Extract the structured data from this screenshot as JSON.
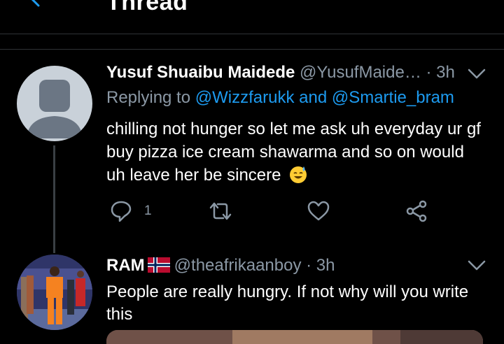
{
  "header": {
    "title": "Thread"
  },
  "tweets": [
    {
      "name": "Yusuf Shuaibu Maidede",
      "handle": "@YusufMaide…",
      "separator": " · ",
      "time": "3h",
      "replying_prefix": "Replying to ",
      "replying_user1": "@Wizzfarukk",
      "replying_and": " and ",
      "replying_user2": "@Smartie_bram",
      "text": "chilling not hunger so let me ask uh everyday ur gf buy pizza ice cream shawarma and so on would uh leave her be sincere",
      "reply_count": "1"
    },
    {
      "name": "RAM",
      "handle": "@theafrikaanboy",
      "separator": " · ",
      "time": "3h",
      "text": "People are really hungry.  If not why will you write this"
    }
  ],
  "colors": {
    "accent": "#1d9bf0",
    "muted": "#8b98a5",
    "background": "#000000"
  },
  "icons": [
    "back-arrow-icon",
    "chevron-down-icon",
    "reply-icon",
    "retweet-icon",
    "like-icon",
    "share-icon",
    "norway-flag-icon",
    "sweat-smile-emoji"
  ]
}
